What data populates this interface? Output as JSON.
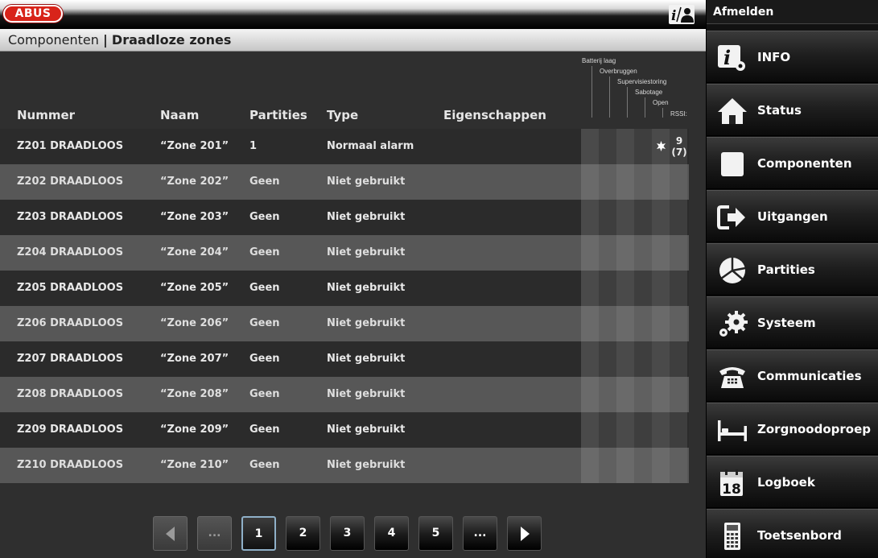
{
  "app": {
    "logo_text": "ABUS"
  },
  "header": {
    "breadcrumb_parent": "Componenten",
    "breadcrumb_separator": "|",
    "breadcrumb_current": "Draadloze zones"
  },
  "table": {
    "columns": [
      "Nummer",
      "Naam",
      "Partities",
      "Type",
      "Eigenschappen"
    ],
    "flag_columns": [
      "Batterij laag",
      "Overbruggen",
      "Supervisiestoring",
      "Sabotage",
      "Open",
      "RSSI:"
    ],
    "rows": [
      {
        "nummer": "Z201 DRAADLOOS",
        "naam": "“Zone 201”",
        "partities": "1",
        "type": "Normaal alarm",
        "open": true,
        "rssi": "9",
        "rssi_sub": "(7)"
      },
      {
        "nummer": "Z202 DRAADLOOS",
        "naam": "“Zone 202”",
        "partities": "Geen",
        "type": "Niet gebruikt"
      },
      {
        "nummer": "Z203 DRAADLOOS",
        "naam": "“Zone 203”",
        "partities": "Geen",
        "type": "Niet gebruikt"
      },
      {
        "nummer": "Z204 DRAADLOOS",
        "naam": "“Zone 204”",
        "partities": "Geen",
        "type": "Niet gebruikt"
      },
      {
        "nummer": "Z205 DRAADLOOS",
        "naam": "“Zone 205”",
        "partities": "Geen",
        "type": "Niet gebruikt"
      },
      {
        "nummer": "Z206 DRAADLOOS",
        "naam": "“Zone 206”",
        "partities": "Geen",
        "type": "Niet gebruikt"
      },
      {
        "nummer": "Z207 DRAADLOOS",
        "naam": "“Zone 207”",
        "partities": "Geen",
        "type": "Niet gebruikt"
      },
      {
        "nummer": "Z208 DRAADLOOS",
        "naam": "“Zone 208”",
        "partities": "Geen",
        "type": "Niet gebruikt"
      },
      {
        "nummer": "Z209 DRAADLOOS",
        "naam": "“Zone 209”",
        "partities": "Geen",
        "type": "Niet gebruikt"
      },
      {
        "nummer": "Z210 DRAADLOOS",
        "naam": "“Zone 210”",
        "partities": "Geen",
        "type": "Niet gebruikt"
      }
    ]
  },
  "pagination": {
    "ellipsis": "...",
    "pages": [
      "1",
      "2",
      "3",
      "4",
      "5"
    ],
    "current_page": "1"
  },
  "sidebar": {
    "logout_label": "Afmelden",
    "items": [
      {
        "label": "INFO",
        "icon": "info-settings-icon"
      },
      {
        "label": "Status",
        "icon": "home-icon"
      },
      {
        "label": "Componenten",
        "icon": "component-square-icon"
      },
      {
        "label": "Uitgangen",
        "icon": "output-arrow-icon"
      },
      {
        "label": "Partities",
        "icon": "partition-pie-icon"
      },
      {
        "label": "Systeem",
        "icon": "gears-icon"
      },
      {
        "label": "Communicaties",
        "icon": "telephone-icon"
      },
      {
        "label": "Zorgnoodoproep",
        "icon": "bed-icon"
      },
      {
        "label": "Logboek",
        "icon": "calendar-icon",
        "icon_text": "18"
      },
      {
        "label": "Toetsenbord",
        "icon": "keypad-icon"
      }
    ]
  },
  "colors": {
    "logo_red": "#d8241a",
    "accent_border": "#8fb0c8"
  }
}
